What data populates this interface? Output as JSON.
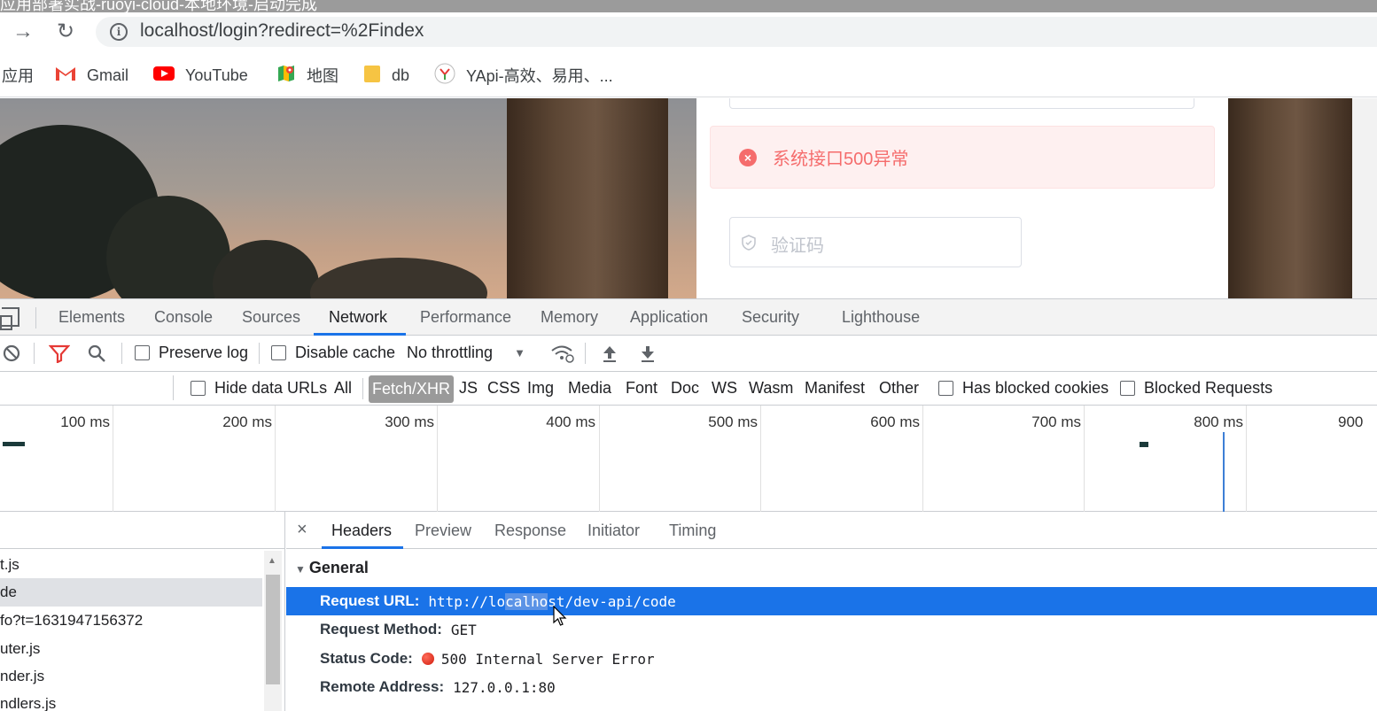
{
  "window": {
    "title": "应用部署实战-ruoyi-cloud-本地环境-启动完成"
  },
  "browser": {
    "url": "localhost/login?redirect=%2Findex",
    "bookmarks": [
      {
        "label": "应用",
        "icon": "apps-grid-icon"
      },
      {
        "label": "Gmail",
        "icon": "gmail-icon"
      },
      {
        "label": "YouTube",
        "icon": "youtube-icon"
      },
      {
        "label": "地图",
        "icon": "maps-icon"
      },
      {
        "label": "db",
        "icon": "folder-icon"
      },
      {
        "label": "YApi-高效、易用、...",
        "icon": "yapi-icon"
      }
    ]
  },
  "login": {
    "alert_text": "系统接口500异常",
    "captcha_placeholder": "验证码",
    "alert_color": "#f56c6c"
  },
  "devtools": {
    "tabs": [
      "Elements",
      "Console",
      "Sources",
      "Network",
      "Performance",
      "Memory",
      "Application",
      "Security",
      "Lighthouse"
    ],
    "active_tab": "Network",
    "toolbar": {
      "preserve_log": "Preserve log",
      "disable_cache": "Disable cache",
      "throttling": "No throttling"
    },
    "filter": {
      "hide_data_urls": "Hide data URLs",
      "types": [
        "All",
        "Fetch/XHR",
        "JS",
        "CSS",
        "Img",
        "Media",
        "Font",
        "Doc",
        "WS",
        "Wasm",
        "Manifest",
        "Other"
      ],
      "selected_type": "Fetch/XHR",
      "has_blocked_cookies": "Has blocked cookies",
      "blocked_requests": "Blocked Requests"
    },
    "timeline_ticks": [
      "100 ms",
      "200 ms",
      "300 ms",
      "400 ms",
      "500 ms",
      "600 ms",
      "700 ms",
      "800 ms",
      "900"
    ],
    "requests": [
      "t.js",
      "de",
      "fo?t=1631947156372",
      "uter.js",
      "nder.js",
      "ndlers.js"
    ],
    "selected_request_index": 1,
    "detail_tabs": [
      "Headers",
      "Preview",
      "Response",
      "Initiator",
      "Timing"
    ],
    "active_detail_tab": "Headers",
    "close_symbol": "×",
    "general_label": "General",
    "general": {
      "request_url_key": "Request URL:",
      "request_url_prefix": "http://lo",
      "request_url_highlight": "calho",
      "request_url_suffix": "st/dev-api/code",
      "method_key": "Request Method:",
      "method_val": "GET",
      "status_key": "Status Code:",
      "status_val": "500 Internal Server Error",
      "remote_key": "Remote Address:",
      "remote_val": "127.0.0.1:80"
    },
    "accent_color": "#1a73e8"
  }
}
